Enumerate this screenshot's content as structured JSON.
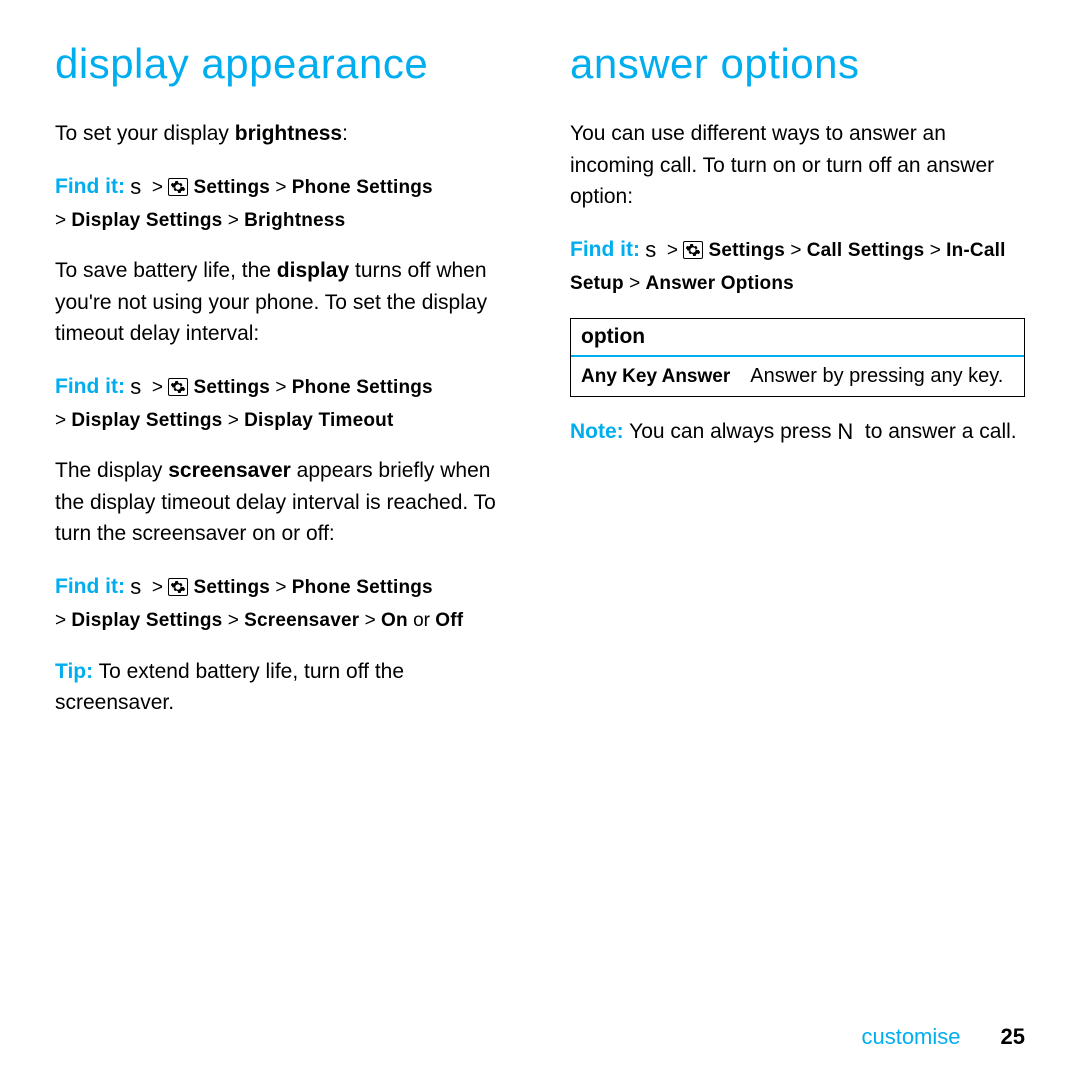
{
  "left": {
    "title": "display appearance",
    "p1_pre": "To set your display ",
    "p1_bold": "brightness",
    "p1_post": ":",
    "find1": {
      "label": "Find it:",
      "s": "s",
      "sep": ">",
      "settings": "Settings",
      "phone_settings": "Phone Settings",
      "display_settings": "Display Settings",
      "leaf": "Brightness"
    },
    "p2_pre": "To save battery life, the ",
    "p2_bold": "display",
    "p2_post": " turns off when you're not using your phone. To set the display timeout delay interval:",
    "find2": {
      "label": "Find it:",
      "s": "s",
      "sep": ">",
      "settings": "Settings",
      "phone_settings": "Phone Settings",
      "display_settings": "Display Settings",
      "leaf": "Display Timeout"
    },
    "p3_pre": "The display ",
    "p3_bold": "screensaver",
    "p3_post": " appears briefly when the display timeout delay interval is reached. To turn the screensaver on or off:",
    "find3": {
      "label": "Find it:",
      "s": "s",
      "sep": ">",
      "settings": "Settings",
      "phone_settings": "Phone Settings",
      "display_settings": "Display Settings",
      "leaf": "Screensaver",
      "on": "On",
      "or": " or ",
      "off": "Off"
    },
    "tip_label": "Tip:",
    "tip_text": " To extend battery life, turn off the screensaver."
  },
  "right": {
    "title": "answer options",
    "p1": "You can use different ways to answer an incoming call. To turn on or turn off an answer option:",
    "find1": {
      "label": "Find it:",
      "s": "s",
      "sep": ">",
      "settings": "Settings",
      "call_settings": "Call Settings",
      "incall": "In-Call Setup",
      "leaf": "Answer Options"
    },
    "table": {
      "header": "option",
      "row1_opt": "Any Key Answer",
      "row1_desc": "Answer by pressing any key."
    },
    "note_label": "Note:",
    "note_pre": " You can always press ",
    "note_N": "N",
    "note_post": " to answer a call."
  },
  "footer": {
    "section": "customise",
    "page": "25"
  }
}
